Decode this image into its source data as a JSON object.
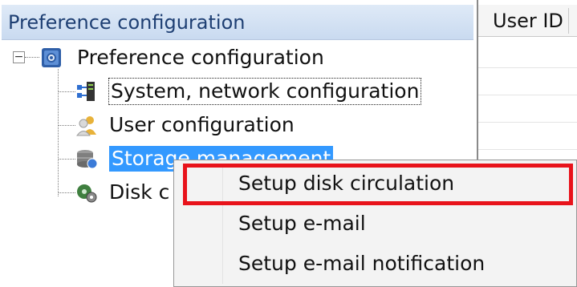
{
  "panel": {
    "title": "Preference configuration"
  },
  "table": {
    "column_header": "User ID"
  },
  "tree": {
    "root": {
      "label": "Preference configuration",
      "icon": "preferences-icon",
      "expander": "−"
    },
    "children": [
      {
        "label": "System, network configuration",
        "icon": "network-icon",
        "state": "focused"
      },
      {
        "label": "User configuration",
        "icon": "users-icon",
        "state": "normal"
      },
      {
        "label": "Storage management",
        "icon": "storage-icon",
        "state": "selected"
      },
      {
        "label": "Disk c",
        "icon": "disk-icon",
        "state": "normal"
      }
    ]
  },
  "context_menu": {
    "items": [
      {
        "label": "Setup disk circulation",
        "highlighted": true
      },
      {
        "label": "Setup e-mail"
      },
      {
        "label": "Setup e-mail notification"
      }
    ],
    "highlight_color": "#e8131b"
  },
  "colors": {
    "selection": "#3399ff",
    "header_text": "#1e3f73"
  }
}
